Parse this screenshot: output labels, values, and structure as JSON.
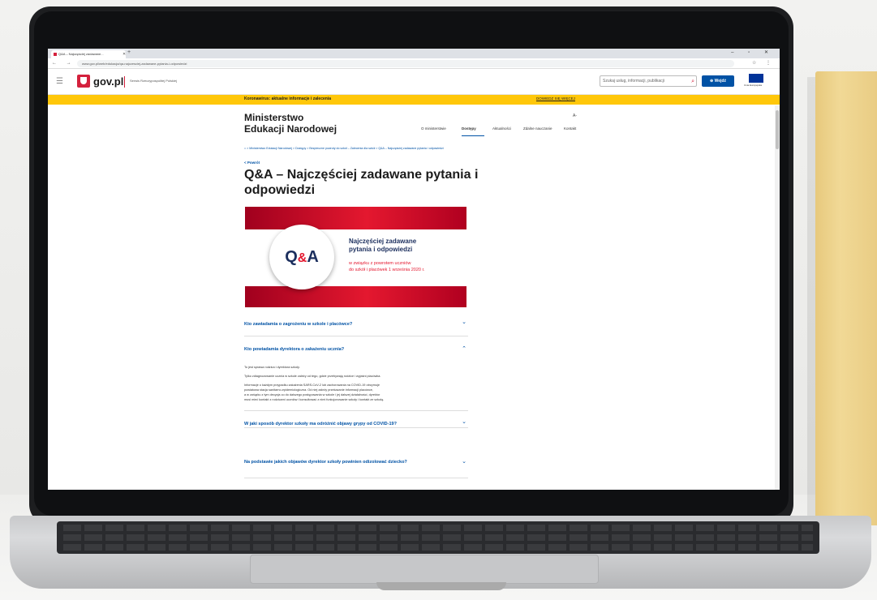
{
  "browser": {
    "tab_title": "Q&A – Najczęściej zadawane...",
    "url": "www.gov.pl/web/edukacja/qa-najczesciej-zadawane-pytania-i-odpowiedzi",
    "new_tab": "+",
    "window_controls": "– ▫ ✕",
    "nav_icons": "← → ⟳",
    "addr_icons": "☆ ⋮"
  },
  "header": {
    "logo_text": "gov.pl",
    "subtitle": "Serwis Rzeczypospolitej Polskiej",
    "search_placeholder": "Szukaj usług, informacji, publikacji",
    "login_label": "⊕ Wejdź",
    "eu_text": "Unia Europejska"
  },
  "banner": {
    "text": "Koronawirus: aktualne informacje i zalecenia",
    "link": "DOWIEDZ SIĘ WIĘCEJ"
  },
  "ministry": {
    "line1": "Ministerstwo",
    "line2": "Edukacji Narodowej",
    "lang": "A-"
  },
  "nav": {
    "items": [
      {
        "label": "O ministerstwie"
      },
      {
        "label": "Dostępy"
      },
      {
        "label": "Aktualności"
      },
      {
        "label": "Zdalne nauczanie"
      },
      {
        "label": "Kontakt"
      }
    ]
  },
  "breadcrumb": "⌂  >  Ministerstwo Edukacji Narodowej  >  Dostępy  >  Bezpieczne powroty do szkół – Zalecenia dla szkół  >  Q&A – Najczęściej zadawane pytania i odpowiedzi",
  "back_label": "< Powrót",
  "page_title": "Q&A – Najczęściej zadawane pytania i odpowiedzi",
  "hero": {
    "circle_q": "Q",
    "circle_amp": "&",
    "circle_a": "A",
    "line1a": "Najczęściej zadawane",
    "line1b": "pytania i odpowiedzi",
    "line2a": "w związku z powrotem uczniów",
    "line2b": "do szkół i placówek 1 września 2020 r."
  },
  "accordion": [
    {
      "question": "Kto zawiadamia o zagrożeniu w szkole i placówce?",
      "chevron": "⌄"
    },
    {
      "question": "Kto powiadamia dyrektora o zakażeniu ucznia?",
      "chevron": "⌃"
    },
    {
      "question": "W jaki sposób dyrektor szkoły ma odróżnić objawy grypy od COVID-19?",
      "chevron": "⌄"
    },
    {
      "question": "Na podstawie jakich objawów dyrektor szkoły powinien odizolować dziecko?",
      "chevron": "⌄"
    }
  ],
  "answer": {
    "p1": "To jest sprawa rodzica i dyrektora szkoły.",
    "p2": "Tylko zdiagnozowanie ucznia w szkole zależy od tego, gdzie przebywają rodzice i wyjaśni placówka.",
    "p3a": "Informacje o każdym przypadku zakażenia SARS-CoV-2 lub zachorowania na COVID-19 otrzymuje",
    "p3b": "powiatowa stacja sanitarno-epidemiologiczna. Od niej zależy przekazanie informacji placówce,",
    "p3c": "a w związku z tym decyzja co do dalszego postępowania w szkole i jej dalszej działalności, dyrektor",
    "p3d": "musi mieć kontakt z rodzicami uczniów i konsultować z nimi funkcjonowanie szkoły i kontakt ze szkołą."
  }
}
